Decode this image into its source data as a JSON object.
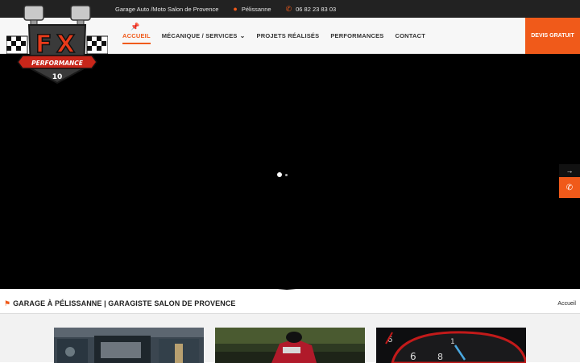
{
  "topbar": {
    "tagline": "Garage Auto /Moto Salon de Provence",
    "location": "Pélissanne",
    "phone": "06 82 23 83 03"
  },
  "logo": {
    "text": "PERFORMANCE",
    "number": "10"
  },
  "nav": {
    "items": [
      {
        "label": "ACCUEIL",
        "active": true
      },
      {
        "label": "MÉCANIQUE / SERVICES",
        "has_dropdown": true
      },
      {
        "label": "PROJETS RÉALISÉS"
      },
      {
        "label": "PERFORMANCES"
      },
      {
        "label": "CONTACT"
      }
    ],
    "cta": "DEVIS GRATUIT"
  },
  "page": {
    "title": "GARAGE À PÉLISSANNE | GARAGISTE SALON DE PROVENCE",
    "breadcrumb": "Accueil"
  },
  "icons": {
    "home": "pin-icon",
    "location": "map-marker-icon",
    "phone": "phone-icon",
    "arrow": "arrow-right-icon",
    "flag": "flag-icon"
  },
  "colors": {
    "accent": "#f05a1a",
    "topbar": "#222222",
    "hero": "#000000"
  }
}
